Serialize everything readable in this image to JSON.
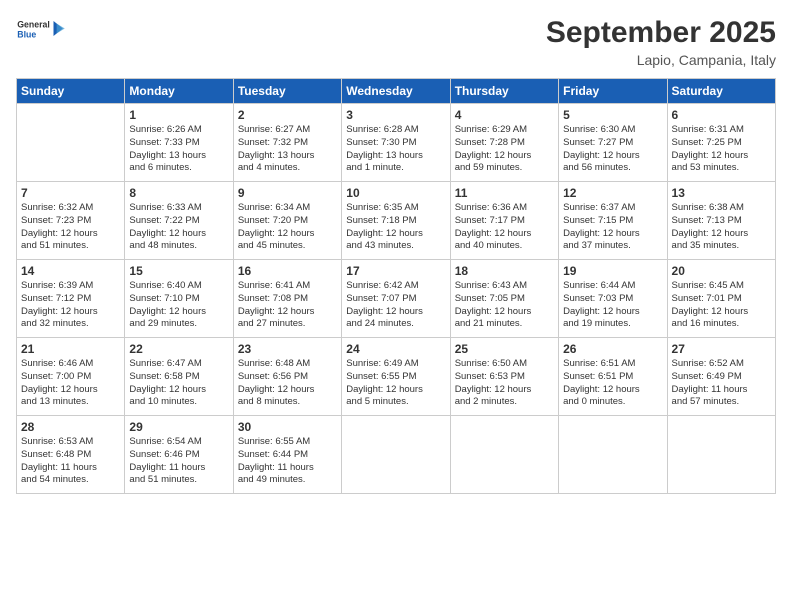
{
  "header": {
    "logo_general": "General",
    "logo_blue": "Blue",
    "month_title": "September 2025",
    "location": "Lapio, Campania, Italy"
  },
  "weekdays": [
    "Sunday",
    "Monday",
    "Tuesday",
    "Wednesday",
    "Thursday",
    "Friday",
    "Saturday"
  ],
  "weeks": [
    [
      {
        "day": "",
        "info": ""
      },
      {
        "day": "1",
        "info": "Sunrise: 6:26 AM\nSunset: 7:33 PM\nDaylight: 13 hours\nand 6 minutes."
      },
      {
        "day": "2",
        "info": "Sunrise: 6:27 AM\nSunset: 7:32 PM\nDaylight: 13 hours\nand 4 minutes."
      },
      {
        "day": "3",
        "info": "Sunrise: 6:28 AM\nSunset: 7:30 PM\nDaylight: 13 hours\nand 1 minute."
      },
      {
        "day": "4",
        "info": "Sunrise: 6:29 AM\nSunset: 7:28 PM\nDaylight: 12 hours\nand 59 minutes."
      },
      {
        "day": "5",
        "info": "Sunrise: 6:30 AM\nSunset: 7:27 PM\nDaylight: 12 hours\nand 56 minutes."
      },
      {
        "day": "6",
        "info": "Sunrise: 6:31 AM\nSunset: 7:25 PM\nDaylight: 12 hours\nand 53 minutes."
      }
    ],
    [
      {
        "day": "7",
        "info": "Sunrise: 6:32 AM\nSunset: 7:23 PM\nDaylight: 12 hours\nand 51 minutes."
      },
      {
        "day": "8",
        "info": "Sunrise: 6:33 AM\nSunset: 7:22 PM\nDaylight: 12 hours\nand 48 minutes."
      },
      {
        "day": "9",
        "info": "Sunrise: 6:34 AM\nSunset: 7:20 PM\nDaylight: 12 hours\nand 45 minutes."
      },
      {
        "day": "10",
        "info": "Sunrise: 6:35 AM\nSunset: 7:18 PM\nDaylight: 12 hours\nand 43 minutes."
      },
      {
        "day": "11",
        "info": "Sunrise: 6:36 AM\nSunset: 7:17 PM\nDaylight: 12 hours\nand 40 minutes."
      },
      {
        "day": "12",
        "info": "Sunrise: 6:37 AM\nSunset: 7:15 PM\nDaylight: 12 hours\nand 37 minutes."
      },
      {
        "day": "13",
        "info": "Sunrise: 6:38 AM\nSunset: 7:13 PM\nDaylight: 12 hours\nand 35 minutes."
      }
    ],
    [
      {
        "day": "14",
        "info": "Sunrise: 6:39 AM\nSunset: 7:12 PM\nDaylight: 12 hours\nand 32 minutes."
      },
      {
        "day": "15",
        "info": "Sunrise: 6:40 AM\nSunset: 7:10 PM\nDaylight: 12 hours\nand 29 minutes."
      },
      {
        "day": "16",
        "info": "Sunrise: 6:41 AM\nSunset: 7:08 PM\nDaylight: 12 hours\nand 27 minutes."
      },
      {
        "day": "17",
        "info": "Sunrise: 6:42 AM\nSunset: 7:07 PM\nDaylight: 12 hours\nand 24 minutes."
      },
      {
        "day": "18",
        "info": "Sunrise: 6:43 AM\nSunset: 7:05 PM\nDaylight: 12 hours\nand 21 minutes."
      },
      {
        "day": "19",
        "info": "Sunrise: 6:44 AM\nSunset: 7:03 PM\nDaylight: 12 hours\nand 19 minutes."
      },
      {
        "day": "20",
        "info": "Sunrise: 6:45 AM\nSunset: 7:01 PM\nDaylight: 12 hours\nand 16 minutes."
      }
    ],
    [
      {
        "day": "21",
        "info": "Sunrise: 6:46 AM\nSunset: 7:00 PM\nDaylight: 12 hours\nand 13 minutes."
      },
      {
        "day": "22",
        "info": "Sunrise: 6:47 AM\nSunset: 6:58 PM\nDaylight: 12 hours\nand 10 minutes."
      },
      {
        "day": "23",
        "info": "Sunrise: 6:48 AM\nSunset: 6:56 PM\nDaylight: 12 hours\nand 8 minutes."
      },
      {
        "day": "24",
        "info": "Sunrise: 6:49 AM\nSunset: 6:55 PM\nDaylight: 12 hours\nand 5 minutes."
      },
      {
        "day": "25",
        "info": "Sunrise: 6:50 AM\nSunset: 6:53 PM\nDaylight: 12 hours\nand 2 minutes."
      },
      {
        "day": "26",
        "info": "Sunrise: 6:51 AM\nSunset: 6:51 PM\nDaylight: 12 hours\nand 0 minutes."
      },
      {
        "day": "27",
        "info": "Sunrise: 6:52 AM\nSunset: 6:49 PM\nDaylight: 11 hours\nand 57 minutes."
      }
    ],
    [
      {
        "day": "28",
        "info": "Sunrise: 6:53 AM\nSunset: 6:48 PM\nDaylight: 11 hours\nand 54 minutes."
      },
      {
        "day": "29",
        "info": "Sunrise: 6:54 AM\nSunset: 6:46 PM\nDaylight: 11 hours\nand 51 minutes."
      },
      {
        "day": "30",
        "info": "Sunrise: 6:55 AM\nSunset: 6:44 PM\nDaylight: 11 hours\nand 49 minutes."
      },
      {
        "day": "",
        "info": ""
      },
      {
        "day": "",
        "info": ""
      },
      {
        "day": "",
        "info": ""
      },
      {
        "day": "",
        "info": ""
      }
    ]
  ]
}
